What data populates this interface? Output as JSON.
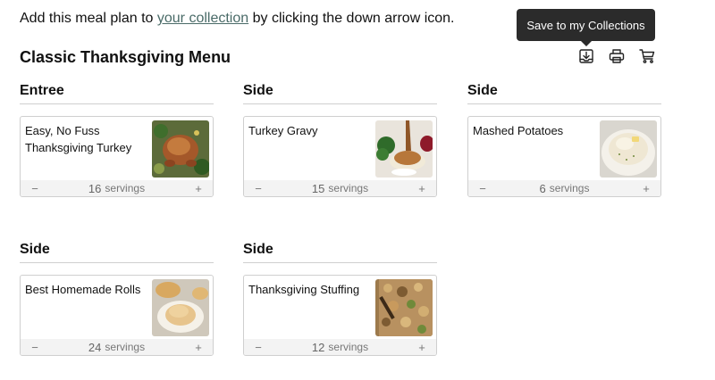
{
  "intro": {
    "before": "Add this meal plan to ",
    "link": "your collection",
    "after": " by clicking the down arrow icon."
  },
  "menu_title": "Classic Thanksgiving Menu",
  "tooltip": "Save to my Collections",
  "actions": [
    {
      "icon": "save-to-collection-icon"
    },
    {
      "icon": "print-icon"
    },
    {
      "icon": "cart-icon"
    }
  ],
  "servings_unit": "servings",
  "stepper": {
    "minus": "−",
    "plus": "+"
  },
  "courses": [
    {
      "label": "Entree",
      "recipe": "Easy, No Fuss Thanksgiving Turkey",
      "servings": "16",
      "image": "roast-turkey"
    },
    {
      "label": "Side",
      "recipe": "Turkey Gravy",
      "servings": "15",
      "image": "turkey-gravy"
    },
    {
      "label": "Side",
      "recipe": "Mashed Potatoes",
      "servings": "6",
      "image": "mashed-potatoes"
    },
    {
      "label": "Side",
      "recipe": "Best Homemade Rolls",
      "servings": "24",
      "image": "homemade-rolls"
    },
    {
      "label": "Side",
      "recipe": "Thanksgiving Stuffing",
      "servings": "12",
      "image": "stuffing"
    }
  ]
}
